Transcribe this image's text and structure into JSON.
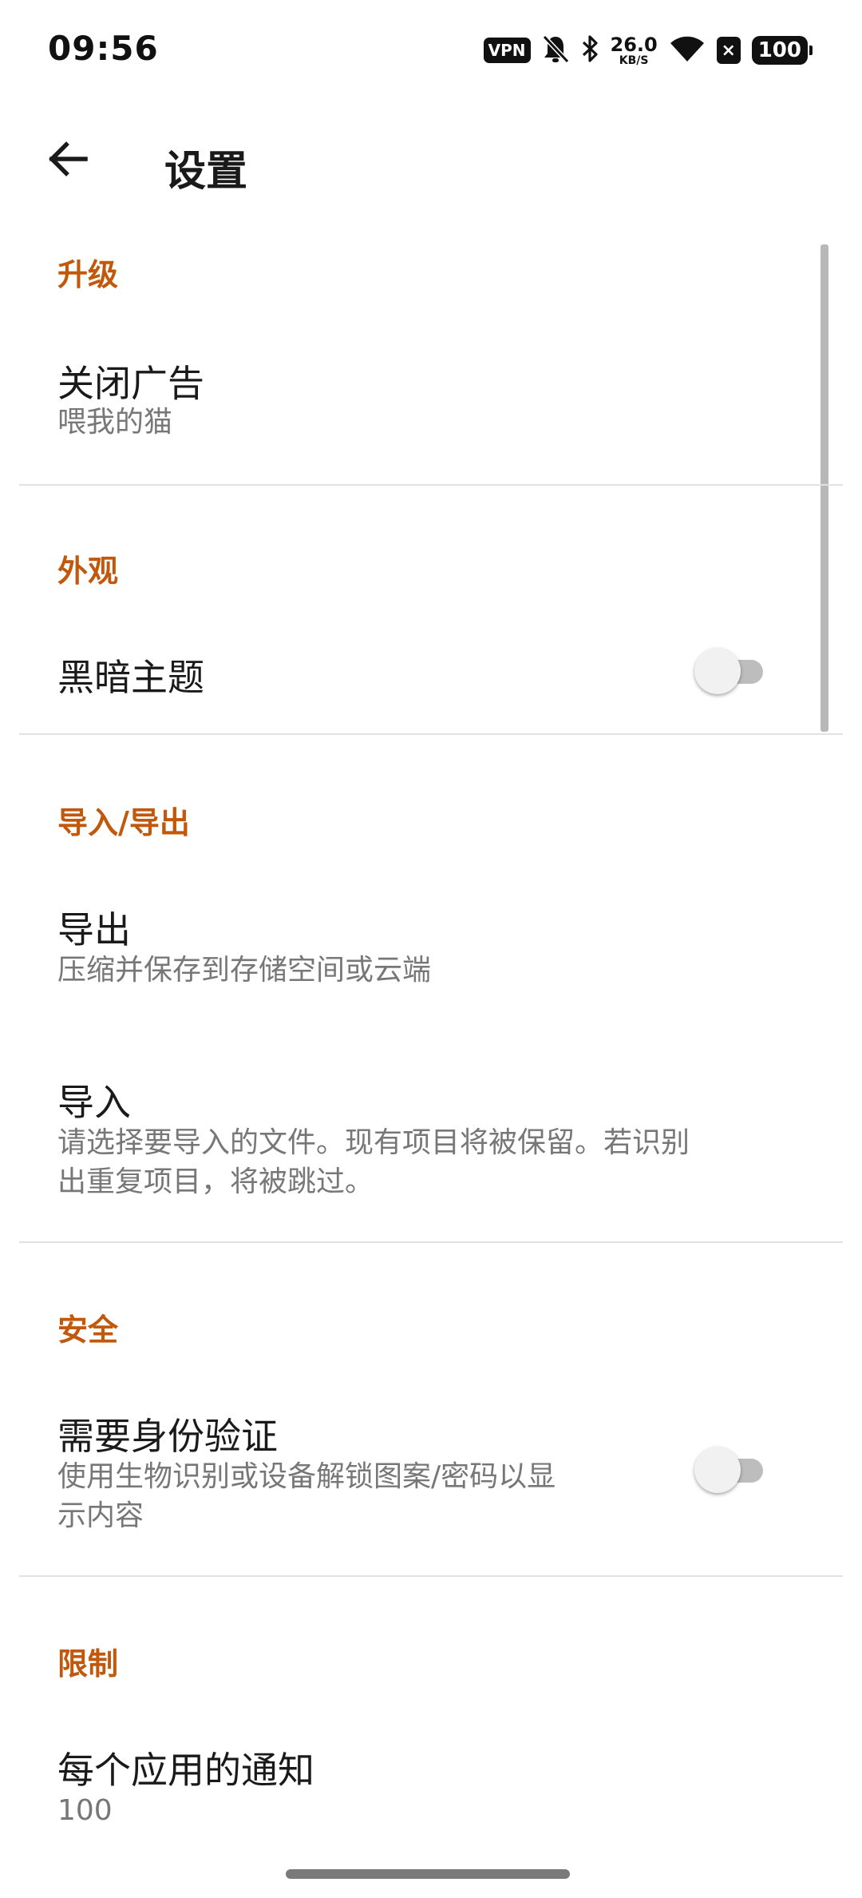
{
  "status_bar": {
    "time": "09:56",
    "vpn": "VPN",
    "net_speed": "26.0",
    "net_unit": "KB/S",
    "battery": "100",
    "icons": [
      "vpn-icon",
      "bell-off-icon",
      "bluetooth-icon",
      "wifi-icon",
      "x-badge-icon",
      "battery-icon"
    ]
  },
  "app_bar": {
    "title": "设置",
    "back_icon": "arrow-left-icon"
  },
  "sections": {
    "upgrade": {
      "header": "升级",
      "close_ads": {
        "title": "关闭广告",
        "summary": "喂我的猫"
      }
    },
    "appearance": {
      "header": "外观",
      "dark_theme": {
        "title": "黑暗主题",
        "enabled": false
      }
    },
    "import_export": {
      "header": "导入/导出",
      "export": {
        "title": "导出",
        "summary": "压缩并保存到存储空间或云端"
      },
      "import": {
        "title": "导入",
        "summary_line1": "请选择要导入的文件。现有项目将被保留。若识别",
        "summary_line2": "出重复项目，将被跳过。"
      }
    },
    "security": {
      "header": "安全",
      "require_auth": {
        "title": "需要身份验证",
        "summary_line1": "使用生物识别或设备解锁图案/密码以显",
        "summary_line2": "示内容",
        "enabled": false
      }
    },
    "limits": {
      "header": "限制",
      "per_app_notifications": {
        "title": "每个应用的通知",
        "value": "100"
      }
    }
  },
  "colors": {
    "accent": "#c1580b",
    "text_primary": "#1a1a1a",
    "text_secondary": "#777777",
    "divider": "#e2e2e2",
    "toggle_off_track": "#bdbdbd",
    "toggle_off_thumb": "#f1f1f1"
  }
}
